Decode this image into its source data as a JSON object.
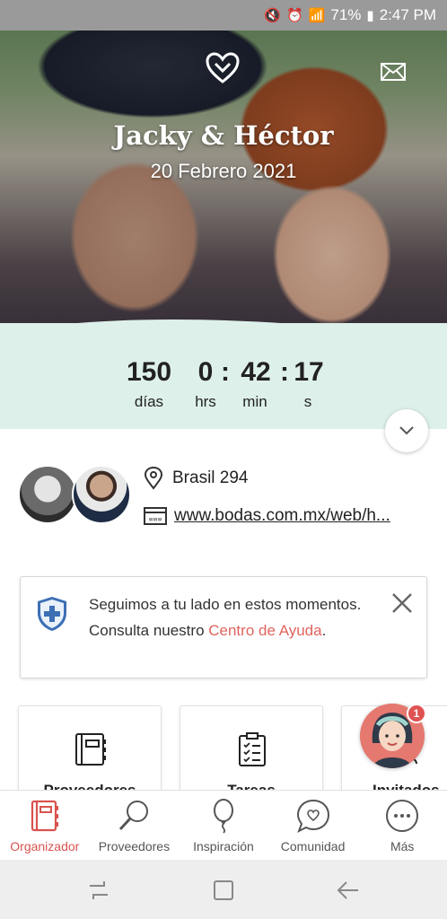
{
  "status_bar": {
    "battery": "71%",
    "time": "2:47 PM"
  },
  "hero": {
    "couple_names": "Jacky & Héctor",
    "date": "20 Febrero 2021"
  },
  "countdown": {
    "days": "150",
    "hours": "0",
    "minutes": "42",
    "seconds": "17",
    "days_label": "días",
    "hours_label": "hrs",
    "minutes_label": "min",
    "seconds_label": "s"
  },
  "info": {
    "location": "Brasil 294",
    "website": "www.bodas.com.mx/web/h..."
  },
  "help_card": {
    "text": "Seguimos a tu lado en estos momentos. Consulta nuestro ",
    "link": "Centro de Ayuda",
    "suffix": "."
  },
  "tiles": [
    {
      "label": "Proveedores"
    },
    {
      "label": "Tareas"
    },
    {
      "label": "Invitados"
    }
  ],
  "assistant": {
    "badge": "1"
  },
  "tabs": [
    {
      "label": "Organizador",
      "active": true
    },
    {
      "label": "Proveedores"
    },
    {
      "label": "Inspiración"
    },
    {
      "label": "Comunidad"
    },
    {
      "label": "Más"
    }
  ],
  "colors": {
    "accent": "#d9534f",
    "countdown_bg": "#def0ea",
    "link": "#e0645e"
  }
}
